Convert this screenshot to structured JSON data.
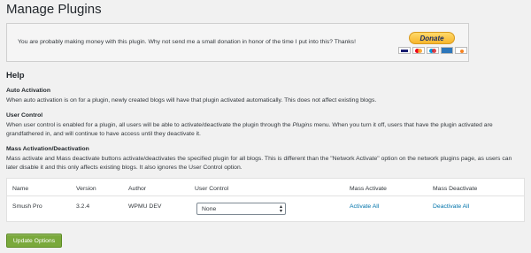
{
  "page": {
    "title": "Manage Plugins"
  },
  "donate": {
    "message": "You are probably making money with this plugin. Why not send me a small donation in honor of the time I put into this? Thanks!",
    "button_label": "Donate"
  },
  "help": {
    "heading": "Help",
    "auto_activation": {
      "title": "Auto Activation",
      "text": "When auto activation is on for a plugin, newly created blogs will have that plugin activated automatically. This does not affect existing blogs."
    },
    "user_control": {
      "title": "User Control",
      "text_before": "When user control is enabled for a plugin, all users will be able to activate/deactivate the plugin through the ",
      "text_italic": "Plugins",
      "text_after": " menu. When you turn it off, users that have the plugin activated are grandfathered in, and will continue to have access until they deactivate it."
    },
    "mass_activation": {
      "title": "Mass Activation/Deactivation",
      "text": "Mass activate and Mass deactivate buttons activate/deactivates the specified plugin for all blogs. This is different than the \"Network Activate\" option on the network plugins page, as users can later disable it and this only affects existing blogs. It also ignores the User Control option."
    }
  },
  "table": {
    "headers": {
      "name": "Name",
      "version": "Version",
      "author": "Author",
      "user_control": "User Control",
      "mass_activate": "Mass Activate",
      "mass_deactivate": "Mass Deactivate"
    },
    "rows": [
      {
        "name": "Smush Pro",
        "version": "3.2.4",
        "author": "WPMU DEV",
        "user_control": "None",
        "activate_label": "Activate All",
        "deactivate_label": "Deactivate All"
      }
    ]
  },
  "actions": {
    "update_label": "Update Options"
  },
  "colors": {
    "link": "#0073aa",
    "update_button": "#7aa93c",
    "donate_button": "#f7b52c"
  },
  "icons": {
    "chevron": "up-down-chevron-icon",
    "cards": [
      "visa-card-icon",
      "mastercard-icon",
      "maestro-card-icon",
      "amex-card-icon",
      "discover-card-icon"
    ]
  }
}
